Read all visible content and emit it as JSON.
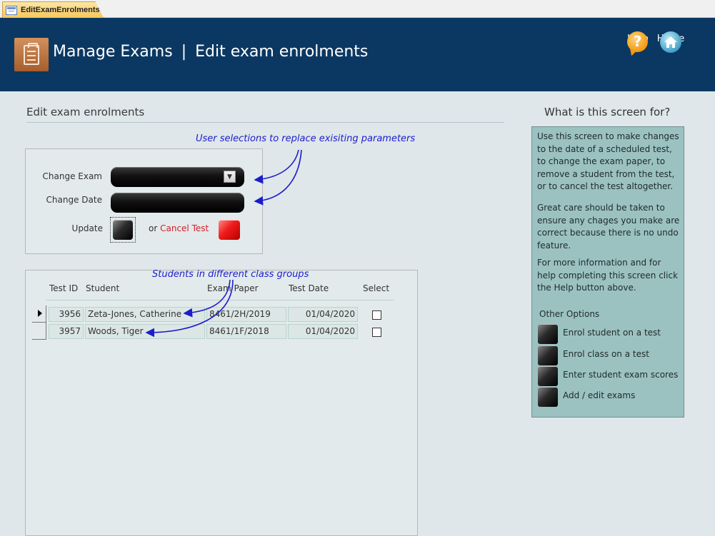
{
  "tab": {
    "label": "EditExamEnrolments"
  },
  "header": {
    "title": "Manage Exams",
    "separator": "|",
    "subtitle": "Edit exam enrolments",
    "help_label": "Help",
    "home_label": "Home"
  },
  "section": {
    "title": "Edit exam enrolments"
  },
  "annotations": {
    "parameters": "User selections to replace exisiting parameters",
    "students": "Students in different class groups"
  },
  "form": {
    "change_exam_label": "Change Exam",
    "change_date_label": "Change Date",
    "update_label": "Update",
    "or_text": "or",
    "cancel_test_label": "Cancel Test"
  },
  "table": {
    "columns": [
      "Test ID",
      "Student",
      "Exam Paper",
      "Test Date",
      "Select"
    ],
    "rows": [
      {
        "test_id": "3956",
        "student": "Zeta-Jones, Catherine",
        "exam_paper": "8461/2H/2019",
        "test_date": "01/04/2020",
        "selected": false
      },
      {
        "test_id": "3957",
        "student": "Woods, Tiger",
        "exam_paper": "8461/1F/2018",
        "test_date": "01/04/2020",
        "selected": false
      }
    ]
  },
  "info": {
    "title": "What is this screen for?",
    "paragraphs": [
      "Use this screen to make changes to the date of a scheduled test, to change the exam paper, to remove a student from the test, or to cancel the test altogether.",
      "Great care should be taken to ensure any chages you make are correct because there is no undo feature.",
      "For more information and for help completing this screen click the Help button above."
    ],
    "other_options_title": "Other Options",
    "options": [
      "Enrol student on a test",
      "Enrol class on a test",
      "Enter student exam scores",
      "Add / edit exams"
    ]
  },
  "colors": {
    "header_bg": "#0b3862",
    "page_bg": "#dfe7ea",
    "info_panel_bg": "#9bc2c1",
    "cancel_red": "#d3202a",
    "annotation_blue": "#1c1ccc"
  }
}
